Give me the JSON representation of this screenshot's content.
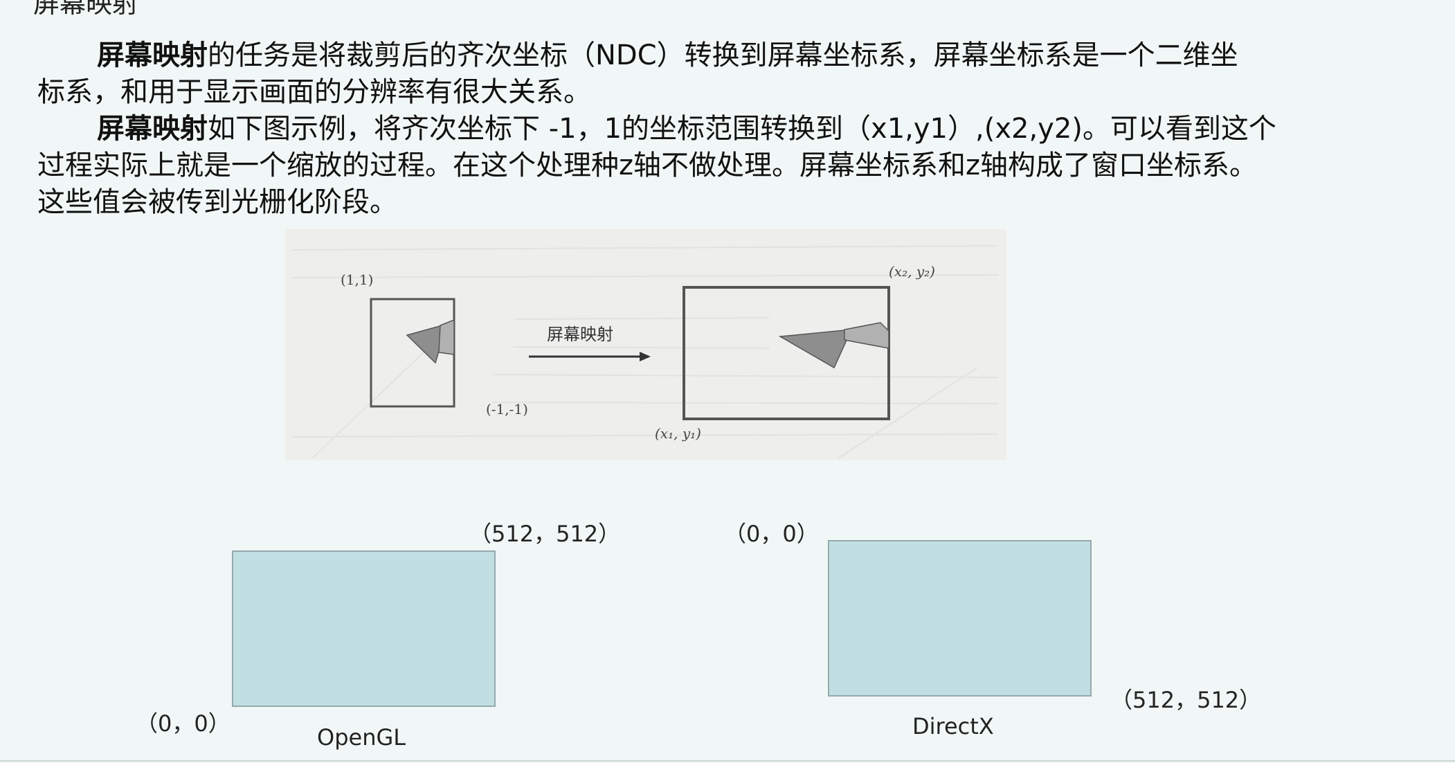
{
  "header_fragment": "屏幕映射",
  "paragraph1": {
    "bold": "屏幕映射",
    "text_line1": "的任务是将裁剪后的齐次坐标（NDC）转换到屏幕坐标系，屏幕坐标系是一个二维坐",
    "text_line2": "标系，和用于显示画面的分辨率有很大关系。"
  },
  "paragraph2": {
    "bold": "屏幕映射",
    "text_line1": "如下图示例，将齐次坐标下 -1，1的坐标范围转换到（x1,y1）,(x2,y2)。可以看到这个",
    "text_line2": "过程实际上就是一个缩放的过程。在这个处理种z轴不做处理。屏幕坐标系和z轴构成了窗口坐标系。",
    "text_line3": "这些值会被传到光栅化阶段。"
  },
  "figure": {
    "ndc_top_left": "(1,1)",
    "ndc_bottom_right": "(-1,-1)",
    "arrow_label": "屏幕映射",
    "screen_top_right": "(x₂, y₂)",
    "screen_bottom_left": "(x₁, y₁)"
  },
  "opengl": {
    "top_right_label": "（512，512）",
    "bottom_left_label": "（0，0）",
    "name": "OpenGL"
  },
  "directx": {
    "top_left_label": "（0，0）",
    "bottom_right_label": "（512，512）",
    "name": "DirectX"
  },
  "colors": {
    "background": "#f1f7f6",
    "box_fill": "#c1dfe2",
    "box_border": "#94a9ac"
  }
}
